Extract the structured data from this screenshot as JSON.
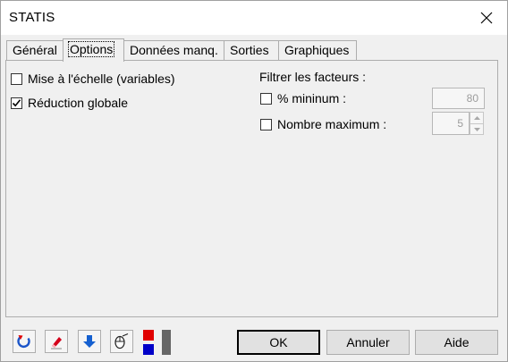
{
  "window": {
    "title": "STATIS"
  },
  "tabs": [
    {
      "label": "Général"
    },
    {
      "label": "Options"
    },
    {
      "label": "Données manq."
    },
    {
      "label": "Sorties"
    },
    {
      "label": "Graphiques"
    }
  ],
  "options": {
    "scaling": {
      "label": "Mise à l'échelle (variables)",
      "checked": false
    },
    "global_reduction": {
      "label": "Réduction globale",
      "checked": true
    }
  },
  "filter": {
    "title": "Filtrer les facteurs :",
    "min_percent": {
      "label": "% mininum :",
      "checked": false,
      "value": "80"
    },
    "max_number": {
      "label": "Nombre maximum :",
      "checked": false,
      "value": "5"
    }
  },
  "buttons": {
    "ok": "OK",
    "cancel": "Annuler",
    "help": "Aide"
  },
  "icons": [
    "reset-icon",
    "eraser-icon",
    "download-arrow-icon",
    "mouse-select-icon",
    "color-picker-icon"
  ],
  "colors": {
    "red": "#e00000",
    "blue": "#0000c8",
    "arrow_blue": "#1560d0"
  }
}
